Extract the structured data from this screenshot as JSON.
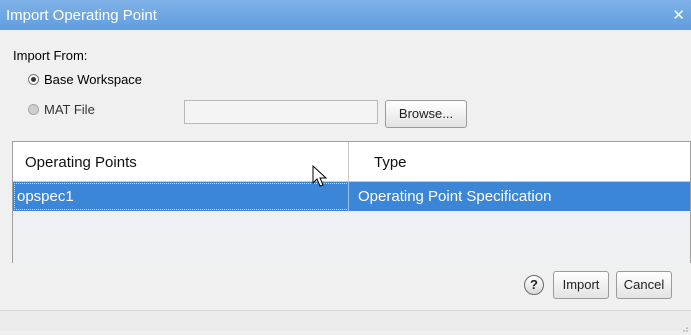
{
  "window": {
    "title": "Import Operating Point",
    "close_glyph": "✕"
  },
  "import_from": {
    "label": "Import From:",
    "options": [
      {
        "label": "Base Workspace",
        "selected": true
      },
      {
        "label": "MAT File",
        "selected": false
      }
    ],
    "file_path_value": "",
    "browse_label": "Browse..."
  },
  "table": {
    "columns": [
      "Operating Points",
      "Type"
    ],
    "rows": [
      {
        "name": "opspec1",
        "type": "Operating Point Specification",
        "selected": true
      }
    ]
  },
  "footer": {
    "help_label": "?",
    "import_label": "Import",
    "cancel_label": "Cancel"
  },
  "colors": {
    "titlebar": "#6aa6e4",
    "selection": "#3b86d6"
  }
}
